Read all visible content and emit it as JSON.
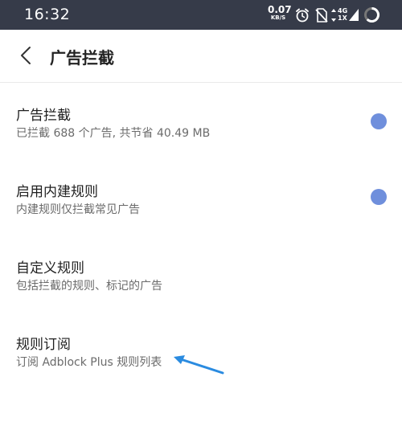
{
  "status_bar": {
    "time": "16:32",
    "net_speed_value": "0.07",
    "net_speed_unit": "KB/S",
    "network_line1": "4G",
    "network_line2": "1X",
    "icons": [
      "alarm-icon",
      "sim-blocked-icon",
      "data-arrows-icon",
      "signal-icon",
      "battery-ring-icon"
    ]
  },
  "header": {
    "back_icon": "chevron-left-icon",
    "title": "广告拦截"
  },
  "settings": {
    "items": [
      {
        "title": "广告拦截",
        "subtitle": "已拦截 688 个广告, 共节省 40.49 MB",
        "toggle": "on"
      },
      {
        "title": "启用内建规则",
        "subtitle": "内建规则仅拦截常见广告",
        "toggle": "on"
      },
      {
        "title": "自定义规则",
        "subtitle": "包括拦截的规则、标记的广告"
      },
      {
        "title": "规则订阅",
        "subtitle": "订阅 Adblock Plus 规则列表"
      }
    ]
  },
  "colors": {
    "status_bar_bg": "#363b49",
    "toggle_accent": "#6f8fdc",
    "annotation_arrow": "#2a8be0"
  }
}
